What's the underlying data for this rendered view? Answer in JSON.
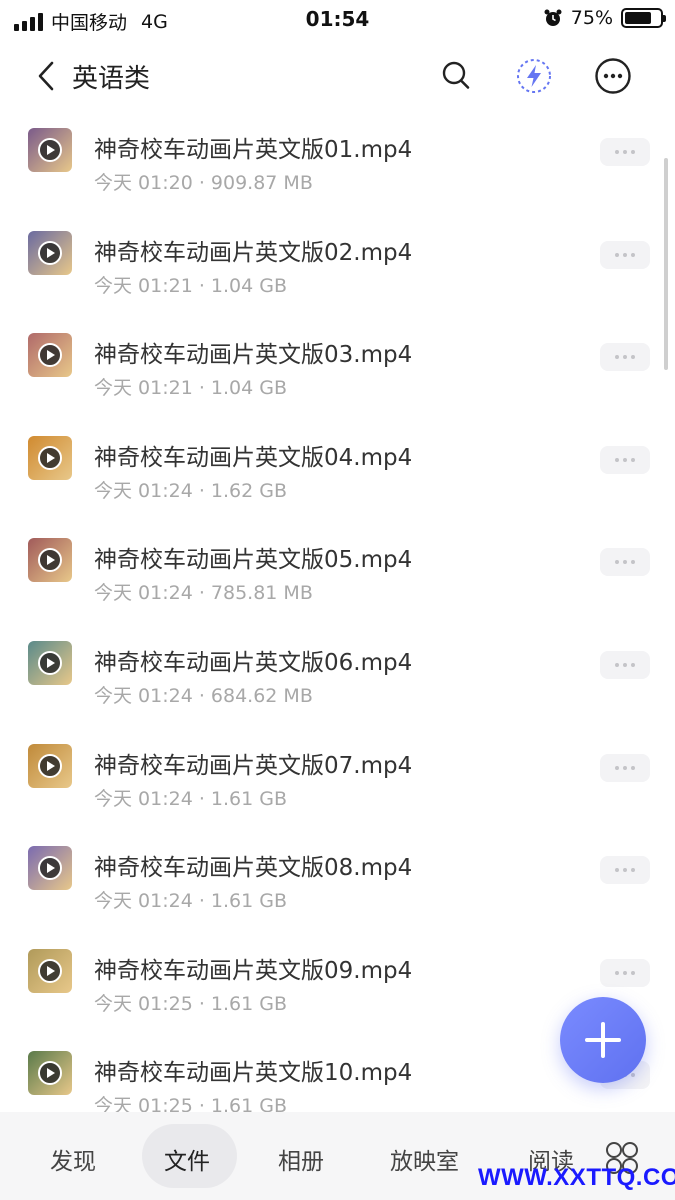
{
  "status_bar": {
    "carrier": "中国移动",
    "network": "4G",
    "time": "01:54",
    "battery_text": "75%",
    "battery_level": 0.75
  },
  "header": {
    "title": "英语类",
    "icons": [
      "back-icon",
      "search-icon",
      "lightning-icon",
      "more-icon"
    ]
  },
  "files": [
    {
      "name": "神奇校车动画片英文版01.mp4",
      "meta": "今天 01:20 · 909.87 MB",
      "thumb_color": "#7a5a8a"
    },
    {
      "name": "神奇校车动画片英文版02.mp4",
      "meta": "今天 01:21 · 1.04 GB",
      "thumb_color": "#6a6aa0"
    },
    {
      "name": "神奇校车动画片英文版03.mp4",
      "meta": "今天 01:21 · 1.04 GB",
      "thumb_color": "#b06a6a"
    },
    {
      "name": "神奇校车动画片英文版04.mp4",
      "meta": "今天 01:24 · 1.62 GB",
      "thumb_color": "#d08a30"
    },
    {
      "name": "神奇校车动画片英文版05.mp4",
      "meta": "今天 01:24 · 785.81 MB",
      "thumb_color": "#a05a5a"
    },
    {
      "name": "神奇校车动画片英文版06.mp4",
      "meta": "今天 01:24 · 684.62 MB",
      "thumb_color": "#5a8a8a"
    },
    {
      "name": "神奇校车动画片英文版07.mp4",
      "meta": "今天 01:24 · 1.61 GB",
      "thumb_color": "#c08a3a"
    },
    {
      "name": "神奇校车动画片英文版08.mp4",
      "meta": "今天 01:24 · 1.61 GB",
      "thumb_color": "#7a6ab0"
    },
    {
      "name": "神奇校车动画片英文版09.mp4",
      "meta": "今天 01:25 · 1.61 GB",
      "thumb_color": "#b09a5a"
    },
    {
      "name": "神奇校车动画片英文版10.mp4",
      "meta": "今天 01:25 · 1.61 GB",
      "thumb_color": "#5a7a4a"
    }
  ],
  "tabbar": {
    "tabs": [
      "发现",
      "文件",
      "相册",
      "放映室",
      "阅读"
    ],
    "active_tab": "文件"
  },
  "fab_icon": "plus-icon",
  "watermark": "WWW.XXTTQ.COM",
  "colors": {
    "accent": "#6576f2",
    "meta_text": "#a8a8a8"
  }
}
